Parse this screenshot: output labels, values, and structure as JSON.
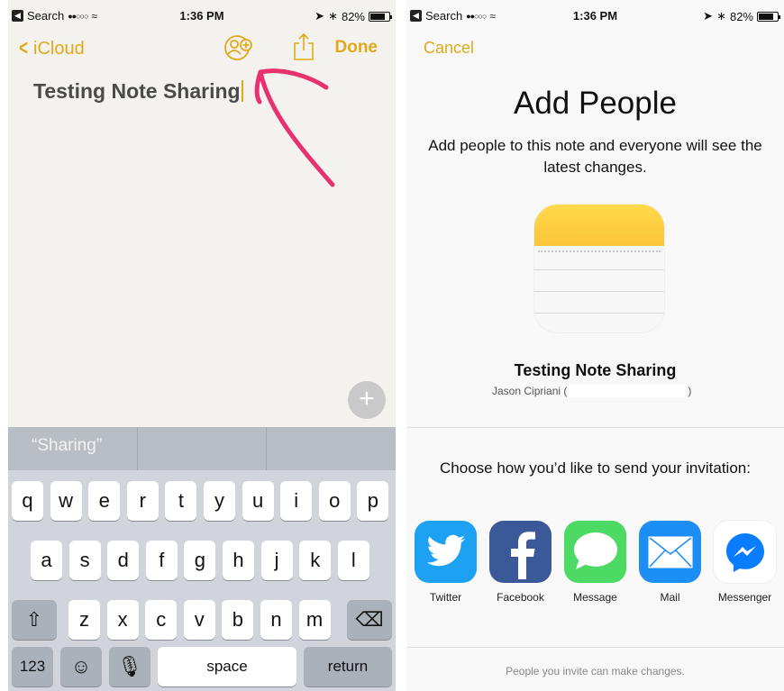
{
  "left": {
    "status": {
      "back_app": "Search",
      "time": "1:36 PM",
      "battery": "82%",
      "battery_level": 0.82
    },
    "nav": {
      "back_label": "iCloud",
      "done_label": "Done"
    },
    "note_title": "Testing Note Sharing",
    "suggestions": [
      "“Sharing”",
      "",
      ""
    ],
    "keyboard": {
      "row1": [
        "q",
        "w",
        "e",
        "r",
        "t",
        "y",
        "u",
        "i",
        "o",
        "p"
      ],
      "row2": [
        "a",
        "s",
        "d",
        "f",
        "g",
        "h",
        "j",
        "k",
        "l"
      ],
      "row3": [
        "z",
        "x",
        "c",
        "v",
        "b",
        "n",
        "m"
      ],
      "numbers_label": "123",
      "space_label": "space",
      "return_label": "return"
    }
  },
  "right": {
    "status": {
      "back_app": "Search",
      "time": "1:36 PM",
      "battery": "82%",
      "battery_level": 0.82
    },
    "cancel_label": "Cancel",
    "title": "Add People",
    "description": "Add people to this note and everyone will see the latest changes.",
    "note_name": "Testing Note Sharing",
    "owner_name": "Jason Cipriani (",
    "owner_close": ")",
    "choose_text": "Choose how you’d like to send your invitation:",
    "share_options": [
      {
        "label": "Twitter",
        "icon": "twitter-icon",
        "color": "#1da1f2"
      },
      {
        "label": "Facebook",
        "icon": "facebook-icon",
        "color": "#3b5998"
      },
      {
        "label": "Message",
        "icon": "message-icon",
        "color": "#4cd964"
      },
      {
        "label": "Mail",
        "icon": "mail-icon",
        "color": "#1e8ef7"
      },
      {
        "label": "Messenger",
        "icon": "messenger-icon",
        "color": "#ffffff"
      }
    ],
    "footer": "People you invite can make changes."
  },
  "colors": {
    "accent": "#e0a91a",
    "annotation_arrow": "#e8326f"
  }
}
